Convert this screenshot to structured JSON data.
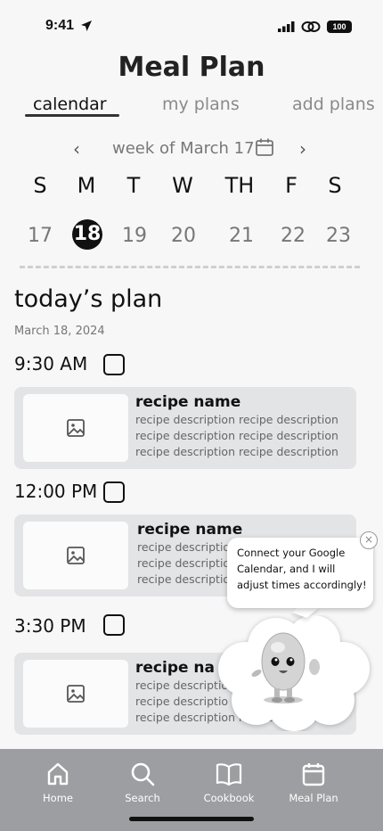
{
  "status_bar": {
    "time": "9:41",
    "battery": "100"
  },
  "page_title": "Meal Plan",
  "tabs": [
    {
      "label": "calendar",
      "active": true
    },
    {
      "label": "my plans",
      "active": false
    },
    {
      "label": "add plans",
      "active": false
    }
  ],
  "week_nav": {
    "prev": "‹",
    "label": "week of March 17",
    "next": "›"
  },
  "day_letters": [
    "S",
    "M",
    "T",
    "W",
    "TH",
    "F",
    "S"
  ],
  "dates": [
    "17",
    "18",
    "19",
    "20",
    "21",
    "22",
    "23"
  ],
  "selected_date": "18",
  "plan": {
    "heading": "today’s plan",
    "date": "March 18, 2024",
    "slots": [
      {
        "time": "9:30 AM",
        "recipe_name": "recipe name",
        "desc": [
          "recipe description recipe description",
          "recipe description recipe description",
          "recipe description recipe description"
        ]
      },
      {
        "time": "12:00 PM",
        "recipe_name": "recipe name",
        "desc": [
          "recipe descriptio",
          "recipe descriptio",
          "recipe descriptio"
        ]
      },
      {
        "time": "3:30 PM",
        "recipe_name": "recipe na",
        "desc": [
          "recipe descriptio",
          "recipe descriptio",
          "recipe description recipe description"
        ]
      }
    ]
  },
  "tooltip": {
    "text": "Connect your Google Calendar, and I will adjust times accordingly!",
    "close": "×"
  },
  "tabbar": [
    {
      "label": "Home",
      "icon": "home-icon"
    },
    {
      "label": "Search",
      "icon": "search-icon"
    },
    {
      "label": "Cookbook",
      "icon": "book-icon"
    },
    {
      "label": "Meal Plan",
      "icon": "calendar-icon"
    }
  ]
}
